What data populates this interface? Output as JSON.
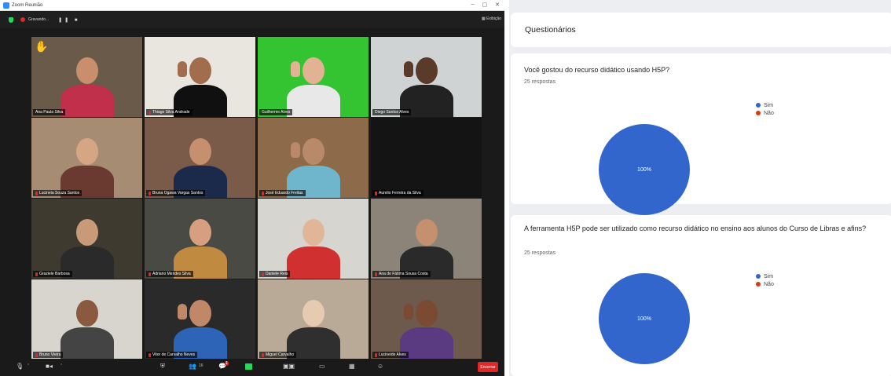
{
  "zoom": {
    "window_title": "Zoom Reunião",
    "window_controls": [
      "–",
      "▢",
      "✕"
    ],
    "recording_label": "Gravando...",
    "recording_controls": "❚❚ ■",
    "view_label": "▦ Exibição",
    "participants": [
      {
        "name": "Ana Paula Silva",
        "raised_hand": true,
        "muted": false
      },
      {
        "name": "Thiago Silva Andrade",
        "raised_hand": false,
        "muted": true,
        "active_speaker": true
      },
      {
        "name": "Guilherme Alves",
        "raised_hand": false,
        "muted": false
      },
      {
        "name": "Diego Santos Alves",
        "raised_hand": false,
        "muted": false
      },
      {
        "name": "Lucineia Souza Santos",
        "raised_hand": false,
        "muted": true
      },
      {
        "name": "Bruna Ogawa Vargas Santos",
        "raised_hand": false,
        "muted": true
      },
      {
        "name": "José Eduardo Freitas",
        "raised_hand": false,
        "muted": true
      },
      {
        "name": "Aurelio Ferreira da Silva",
        "raised_hand": false,
        "muted": true
      },
      {
        "name": "Graziele Barbosa",
        "raised_hand": false,
        "muted": true
      },
      {
        "name": "Adriano Mendes Silva",
        "raised_hand": false,
        "muted": true
      },
      {
        "name": "Daniele Reis",
        "raised_hand": false,
        "muted": true
      },
      {
        "name": "Ana de Fátima Sousa Costa",
        "raised_hand": false,
        "muted": true
      },
      {
        "name": "Bruno Vieira",
        "raised_hand": false,
        "muted": true
      },
      {
        "name": "Vitor de Carvalho Neves",
        "raised_hand": false,
        "muted": true
      },
      {
        "name": "Miguel Carvalho",
        "raised_hand": false,
        "muted": true
      },
      {
        "name": "Lucineide Alves",
        "raised_hand": false,
        "muted": true
      }
    ],
    "toolbar": {
      "mute_icon": "microphone-icon",
      "video_icon": "camera-icon",
      "security_icon": "shield-icon",
      "participants_count": "16",
      "chat_badge": "1",
      "end_label": "Encerrar"
    }
  },
  "forms": {
    "header": "Questionários",
    "questions": [
      {
        "title": "Você gostou do recurso didático usando H5P?",
        "responses": "25 respostas",
        "legend": [
          {
            "label": "Sim",
            "color": "#3366cc"
          },
          {
            "label": "Não",
            "color": "#dc3912"
          }
        ],
        "pie_label": "100%"
      },
      {
        "title": "A ferramenta H5P pode ser utilizado como recurso didático no ensino aos alunos do Curso de Libras e afins?",
        "responses": "25 respostas",
        "legend": [
          {
            "label": "Sim",
            "color": "#3366cc"
          },
          {
            "label": "Não",
            "color": "#dc3912"
          }
        ],
        "pie_label": "100%"
      }
    ]
  },
  "chart_data": [
    {
      "type": "pie",
      "title": "Você gostou do recurso didático usando H5P?",
      "categories": [
        "Sim",
        "Não"
      ],
      "values": [
        100,
        0
      ],
      "colors": [
        "#3366cc",
        "#dc3912"
      ],
      "data_labels": [
        "100%"
      ],
      "legend_placement": "right"
    },
    {
      "type": "pie",
      "title": "A ferramenta H5P pode ser utilizado como recurso didático no ensino aos alunos do Curso de Libras e afins?",
      "categories": [
        "Sim",
        "Não"
      ],
      "values": [
        100,
        0
      ],
      "colors": [
        "#3366cc",
        "#dc3912"
      ],
      "data_labels": [
        "100%"
      ],
      "legend_placement": "right"
    }
  ]
}
